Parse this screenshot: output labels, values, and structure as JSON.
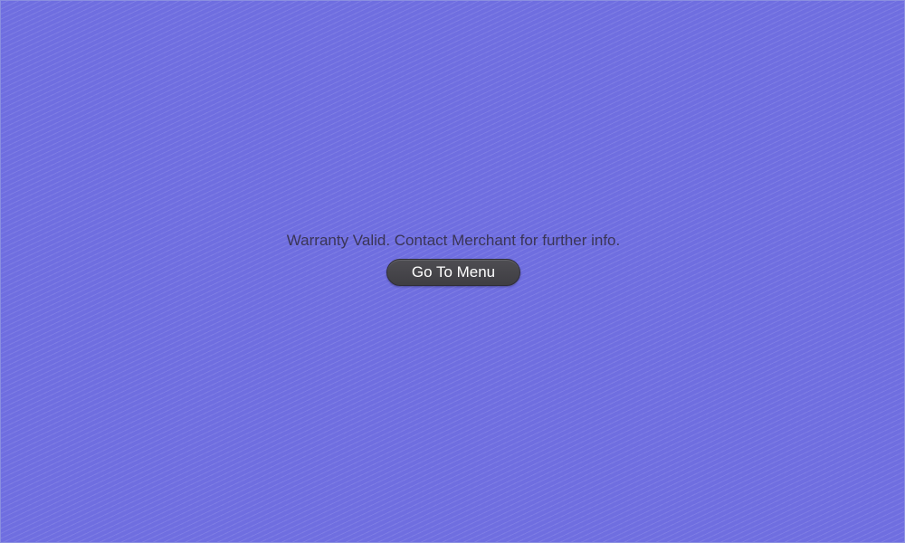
{
  "message": "Warranty Valid. Contact Merchant for further info.",
  "menu_button_label": "Go To Menu",
  "colors": {
    "background": "#6f6ee0",
    "button": "#47464b",
    "message_text": "#3a3556"
  }
}
